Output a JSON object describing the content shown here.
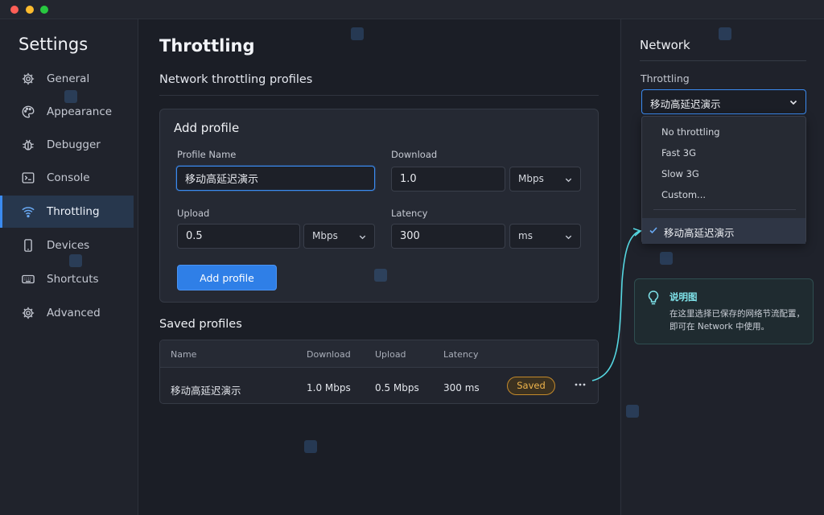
{
  "sidebar": {
    "title": "Settings",
    "items": [
      {
        "label": "General",
        "icon": "gear-icon"
      },
      {
        "label": "Appearance",
        "icon": "palette-icon"
      },
      {
        "label": "Debugger",
        "icon": "bug-icon"
      },
      {
        "label": "Console",
        "icon": "terminal-icon"
      },
      {
        "label": "Throttling",
        "icon": "wifi-icon",
        "active": true
      },
      {
        "label": "Devices",
        "icon": "phone-icon"
      },
      {
        "label": "Shortcuts",
        "icon": "keyboard-icon"
      },
      {
        "label": "Advanced",
        "icon": "gear-icon"
      }
    ]
  },
  "main": {
    "title": "Throttling",
    "subtitle": "Network throttling profiles",
    "add_profile": {
      "title": "Add profile",
      "profile_name_label": "Profile Name",
      "profile_name_value": "移动高延迟演示",
      "download_label": "Download",
      "download_value": "1.0",
      "download_unit": "Mbps",
      "upload_label": "Upload",
      "upload_value": "0.5",
      "upload_unit": "Mbps",
      "latency_label": "Latency",
      "latency_value": "300",
      "latency_unit": "ms",
      "button_label": "Add profile"
    },
    "saved": {
      "title": "Saved profiles",
      "columns": [
        "Name",
        "Download",
        "Upload",
        "Latency"
      ],
      "rows": [
        {
          "name": "移动高延迟演示",
          "download": "1.0 Mbps",
          "upload": "0.5 Mbps",
          "latency": "300 ms",
          "status": "Saved"
        }
      ]
    }
  },
  "network_panel": {
    "title": "Network",
    "throttling_label": "Throttling",
    "selected_value": "移动高延迟演示",
    "options": [
      "No throttling",
      "Fast 3G",
      "Slow 3G",
      "Custom..."
    ],
    "selected_option": "移动高延迟演示",
    "note_title": "说明图",
    "note_text": "在这里选择已保存的网络节流配置，即可在 Network 中使用。"
  },
  "colors": {
    "accent": "#3b8bf0",
    "saved_badge": "#f0b54c",
    "callout": "#55d6e0"
  }
}
